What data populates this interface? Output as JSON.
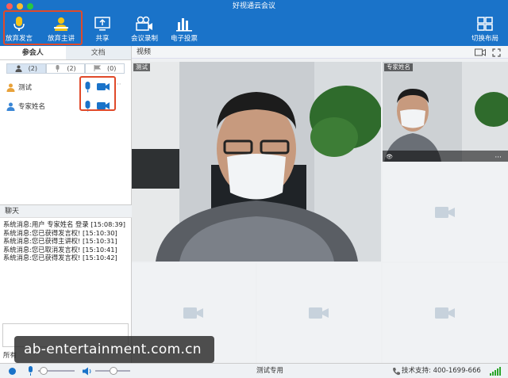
{
  "window": {
    "title": "好视通云会议"
  },
  "toolbar": {
    "release_speak": "放弃发言",
    "release_host": "放弃主讲",
    "share": "共享",
    "record": "会议录制",
    "vote": "电子投票",
    "switch_layout": "切换布局"
  },
  "left_panel": {
    "tabs": [
      {
        "label": "参会人"
      },
      {
        "label": "文档"
      }
    ],
    "filters": [
      {
        "count": "(2)"
      },
      {
        "count": "(2)"
      },
      {
        "count": "(0)"
      }
    ],
    "participants": [
      {
        "name": "测试"
      },
      {
        "name": "专家姓名"
      }
    ],
    "chat": {
      "title": "聊天",
      "messages": [
        "系统消息:用户 专家姓名 登录 [15:08:39]",
        "系统消息:您已获得发言权! [15:10:30]",
        "系统消息:您已获得主讲权! [15:10:31]",
        "系统消息:您已取消发言权! [15:10:41]",
        "系统消息:您已获得发言权! [15:10:42]"
      ],
      "recipient_prefix": "所有"
    }
  },
  "video": {
    "header": "视频",
    "main_label": "测试",
    "side_label": "专家姓名"
  },
  "status": {
    "center": "测试专用",
    "support": "技术支持: 400-1699-666"
  },
  "watermark": "ab-entertainment.com.cn",
  "colors": {
    "accent": "#1a73c9",
    "highlight": "#e04a2a",
    "mic": "#1a73c9"
  }
}
